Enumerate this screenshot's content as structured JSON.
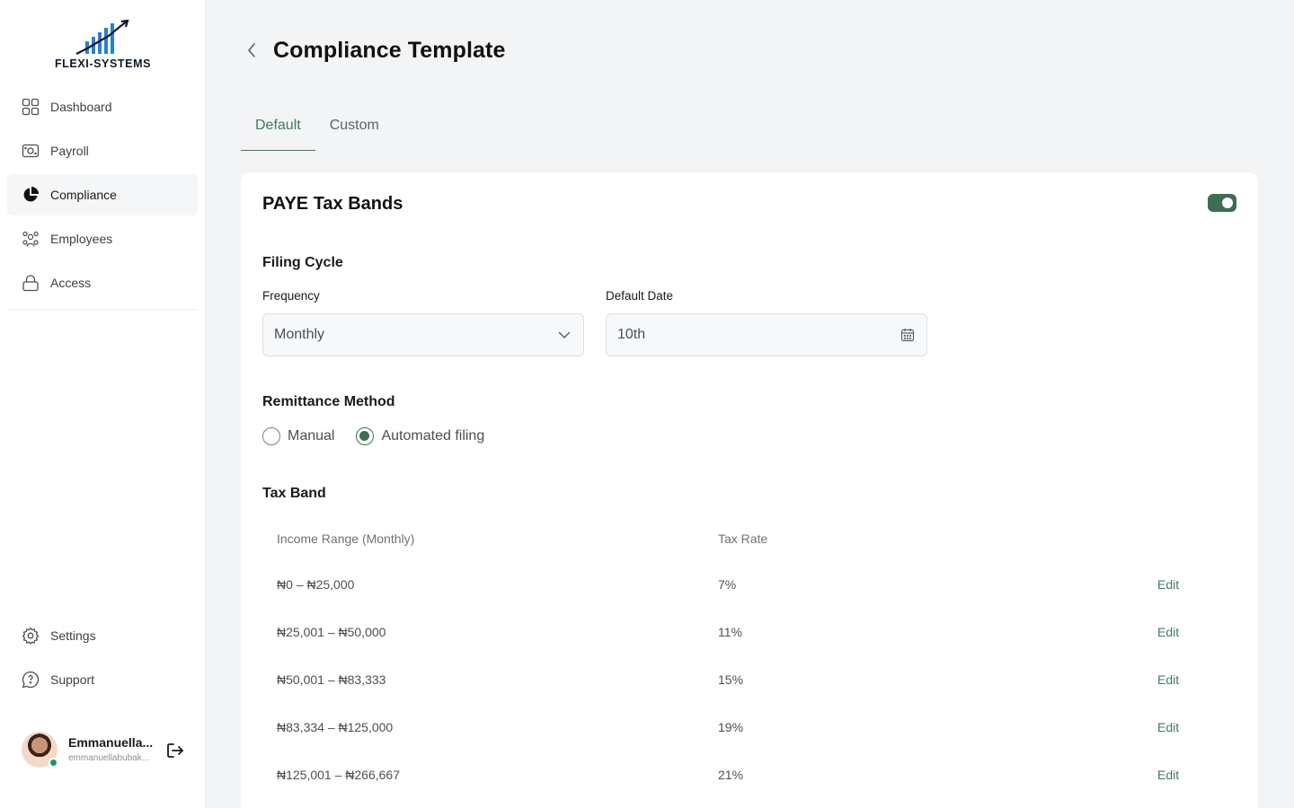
{
  "brand": {
    "name": "FLEXI-SYSTEMS",
    "accent": "#3d6e54"
  },
  "sidebar": {
    "items": [
      {
        "label": "Dashboard",
        "icon": "grid-icon"
      },
      {
        "label": "Payroll",
        "icon": "money-icon"
      },
      {
        "label": "Compliance",
        "icon": "pie-chart-icon",
        "active": true
      },
      {
        "label": "Employees",
        "icon": "users-icon"
      },
      {
        "label": "Access",
        "icon": "lock-icon"
      }
    ],
    "bottom_items": [
      {
        "label": "Settings",
        "icon": "gear-icon"
      },
      {
        "label": "Support",
        "icon": "help-bubble-icon"
      }
    ],
    "user": {
      "name": "Emmanuella...",
      "email": "emmanuellabubak..."
    }
  },
  "header": {
    "title": "Compliance Template"
  },
  "tabs": [
    {
      "label": "Default",
      "active": true
    },
    {
      "label": "Custom",
      "active": false
    }
  ],
  "card": {
    "title": "PAYE Tax Bands",
    "enabled": true,
    "filing_cycle": {
      "title": "Filing Cycle",
      "frequency_label": "Frequency",
      "frequency_value": "Monthly",
      "date_label": "Default Date",
      "date_value": "10th"
    },
    "remittance": {
      "title": "Remittance Method",
      "options": [
        "Manual",
        "Automated filing"
      ],
      "selected": "Automated filing"
    },
    "tax_band": {
      "title": "Tax Band",
      "headers": [
        "Income Range (Monthly)",
        "Tax Rate"
      ],
      "rows": [
        {
          "range": "₦0 – ₦25,000",
          "rate": "7%",
          "action": "Edit"
        },
        {
          "range": "₦25,001 – ₦50,000",
          "rate": "11%",
          "action": "Edit"
        },
        {
          "range": "₦50,001 – ₦83,333",
          "rate": "15%",
          "action": "Edit"
        },
        {
          "range": "₦83,334 – ₦125,000",
          "rate": "19%",
          "action": "Edit"
        },
        {
          "range": "₦125,001 – ₦266,667",
          "rate": "21%",
          "action": "Edit"
        }
      ]
    }
  }
}
